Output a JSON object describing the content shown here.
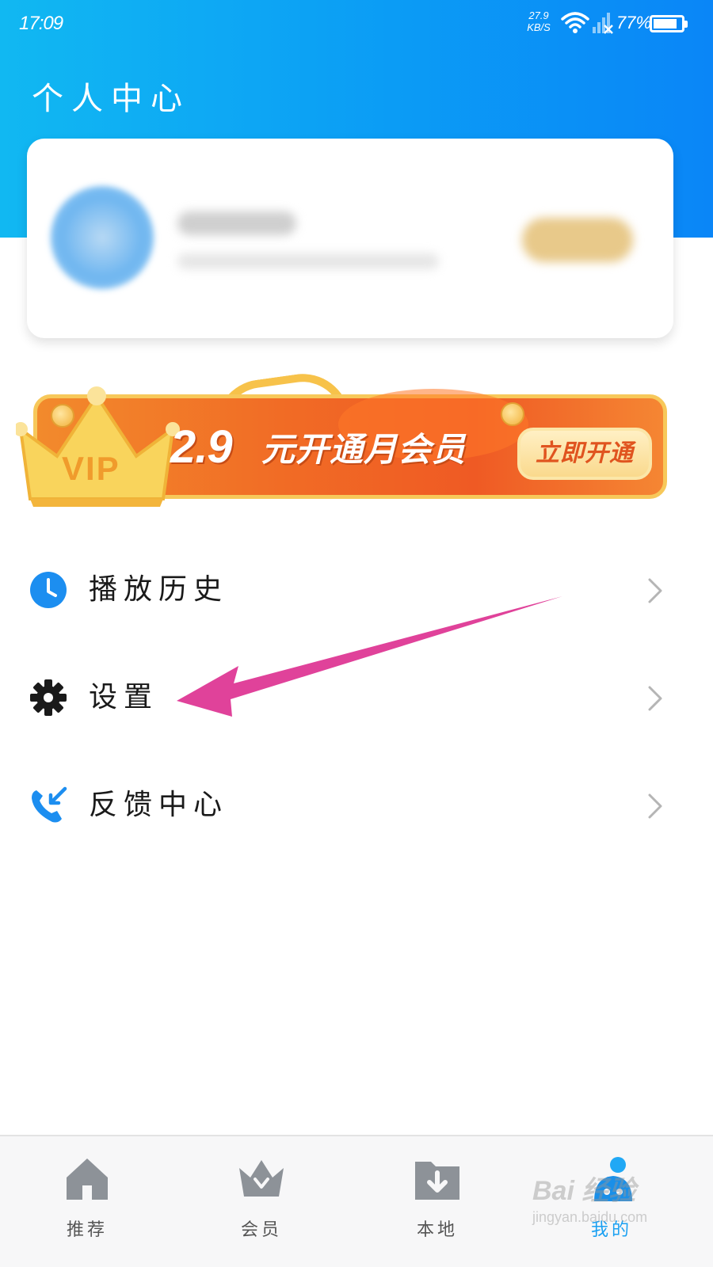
{
  "status_bar": {
    "time": "17:09",
    "net_speed_value": "27.9",
    "net_speed_unit": "KB/S",
    "battery_pct": "77%",
    "battery_level": 0.77
  },
  "header": {
    "title": "个人中心",
    "gradient_colors": [
      "#11b8f2",
      "#0a86f7"
    ]
  },
  "vip_banner": {
    "crown_label": "VIP",
    "price": "2.9",
    "promo_text": "元开通月会员",
    "cta_label": "立即开通",
    "colors": {
      "orange": "#f16b25",
      "gold": "#f7c85a"
    }
  },
  "menu": {
    "items": [
      {
        "label": "播放历史",
        "icon": "clock-icon"
      },
      {
        "label": "设置",
        "icon": "gear-icon"
      },
      {
        "label": "反馈中心",
        "icon": "phone-callback-icon"
      }
    ]
  },
  "bottom_nav": {
    "items": [
      {
        "label": "推荐",
        "icon": "home-icon",
        "active": false
      },
      {
        "label": "会员",
        "icon": "crown-icon",
        "active": false
      },
      {
        "label": "本地",
        "icon": "download-folder-icon",
        "active": false
      },
      {
        "label": "我的",
        "icon": "person-icon",
        "active": true
      }
    ],
    "active_color": "#1aa0f2"
  },
  "watermark": {
    "main": "Bai 经验",
    "sub": "jingyan.baidu.com"
  },
  "annotation": {
    "arrow_color": "#e0429a"
  }
}
